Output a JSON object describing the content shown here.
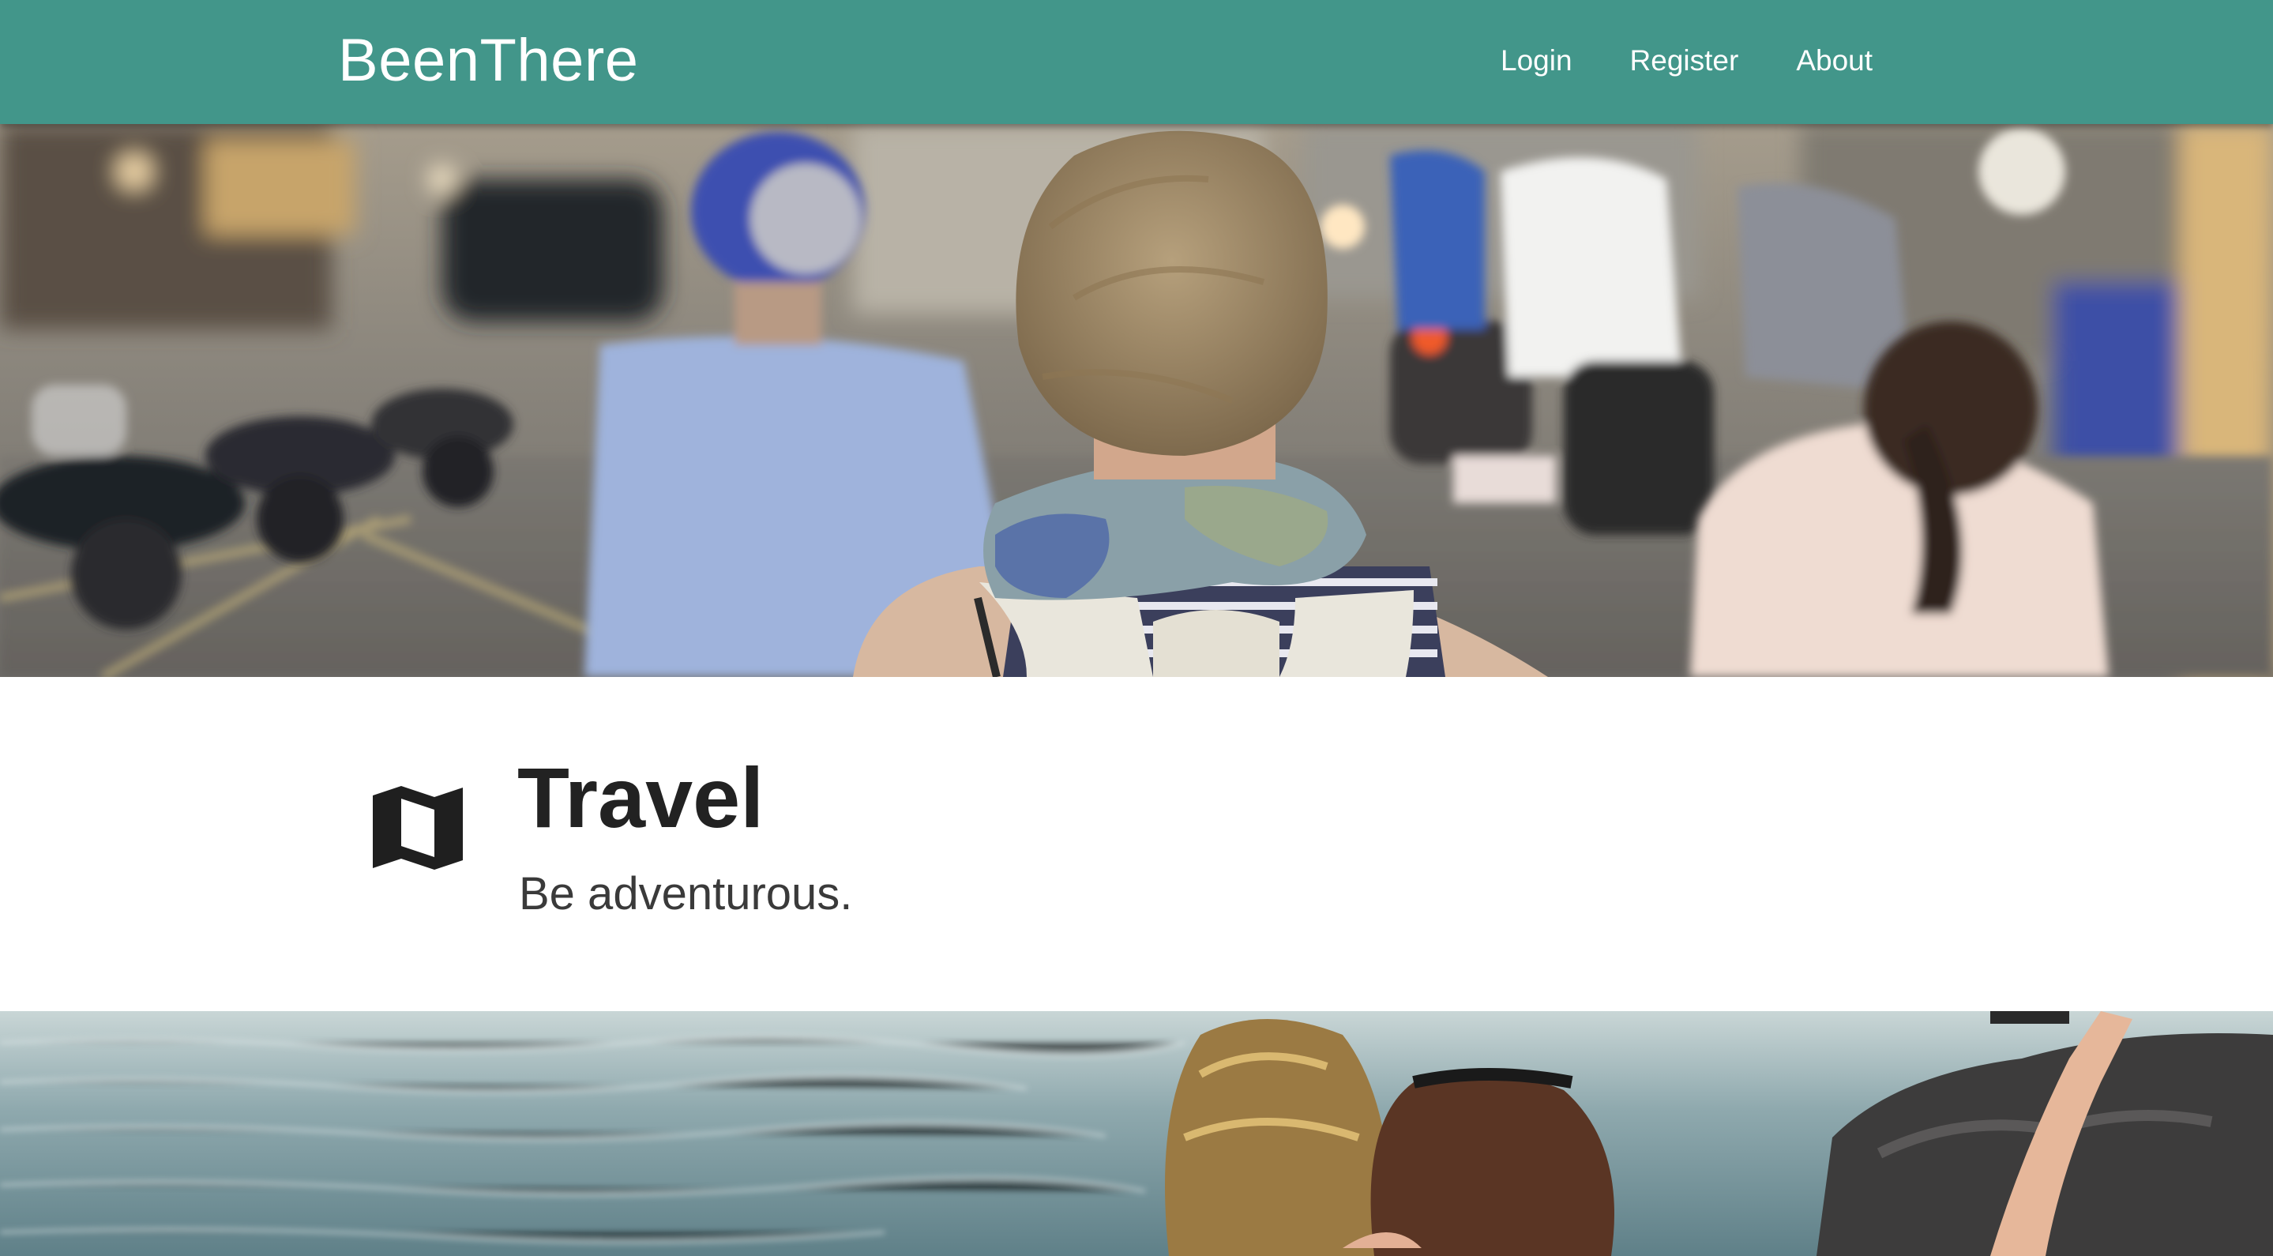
{
  "header": {
    "brand": "BeenThere",
    "nav": [
      {
        "label": "Login"
      },
      {
        "label": "Register"
      },
      {
        "label": "About"
      }
    ],
    "color": "#42968a"
  },
  "hero_top": {
    "description_icon": "street-photo"
  },
  "feature": {
    "icon": "map-icon",
    "title": "Travel",
    "subtitle": "Be adventurous."
  },
  "hero_bottom": {
    "description_icon": "sea-photo"
  }
}
